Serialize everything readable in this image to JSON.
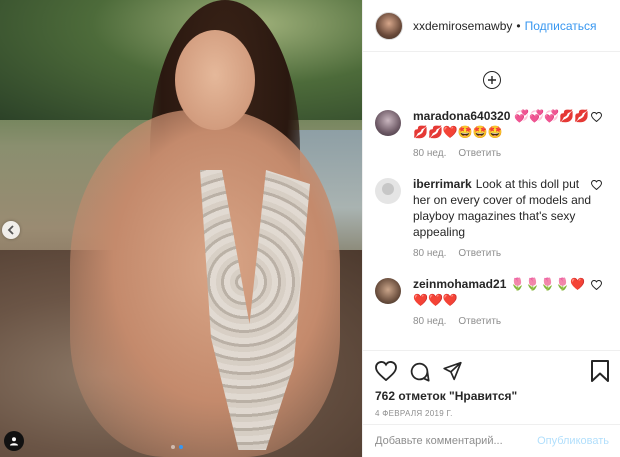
{
  "post": {
    "username": "xxdemirosemawby",
    "separator": "•",
    "follow_label": "Подписаться",
    "likes_text": "762 отметок \"Нравится\"",
    "date_text": "4 ФЕВРАЛЯ 2019 Г.",
    "carousel": {
      "slides": 2,
      "active_index": 1
    }
  },
  "comments": [
    {
      "author": "maradona640320",
      "text": "💞💞💞💋💋💋💋❤️🤩🤩🤩",
      "age": "80 нед.",
      "reply_label": "Ответить"
    },
    {
      "author": "iberrimark",
      "text": "Look at this doll put her on every cover of models and playboy magazines that's sexy appealing",
      "age": "80 нед.",
      "reply_label": "Ответить"
    },
    {
      "author": "zeinmohamad21",
      "text": "🌷🌷🌷🌷❤️❤️❤️❤️",
      "age": "80 нед.",
      "reply_label": "Ответить"
    }
  ],
  "composer": {
    "placeholder": "Добавьте комментарий...",
    "publish_label": "Опубликовать"
  },
  "colors": {
    "accent": "#3897f0",
    "publish_disabled": "#b2dffc",
    "muted": "#8e8e8e",
    "text": "#262626"
  },
  "icons": {
    "prev": "chevron-left-icon",
    "tag": "user-tag-icon",
    "load_more": "plus-circle-icon",
    "like": "heart-icon",
    "comment": "comment-icon",
    "share": "send-icon",
    "save": "bookmark-icon"
  }
}
